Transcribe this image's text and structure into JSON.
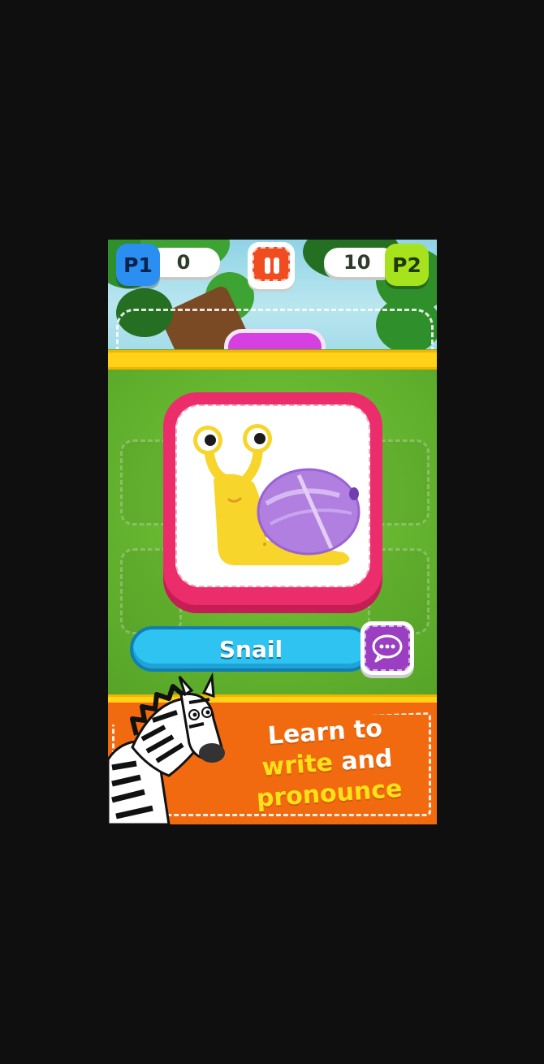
{
  "hud": {
    "player1": {
      "badge": "P1",
      "score": "0",
      "color": "#2a8ff0"
    },
    "player2": {
      "badge": "P2",
      "score": "10",
      "color": "#a6e31c"
    },
    "pause_icon": "pause-icon"
  },
  "card": {
    "picture": "snail",
    "word": "Snail",
    "speak_icon": "speech-bubble-icon",
    "frame_color": "#ec2d6b"
  },
  "promo": {
    "line1": "Learn to",
    "line2_highlight": "write",
    "line2_rest": " and",
    "line3": "pronounce",
    "mascot": "zebra"
  },
  "colors": {
    "background": "#0f0f0f",
    "grass": "#5fb12f",
    "rail": "#ffd21a",
    "banner": "#f26a0f",
    "word_bar": "#2ec3f0"
  }
}
